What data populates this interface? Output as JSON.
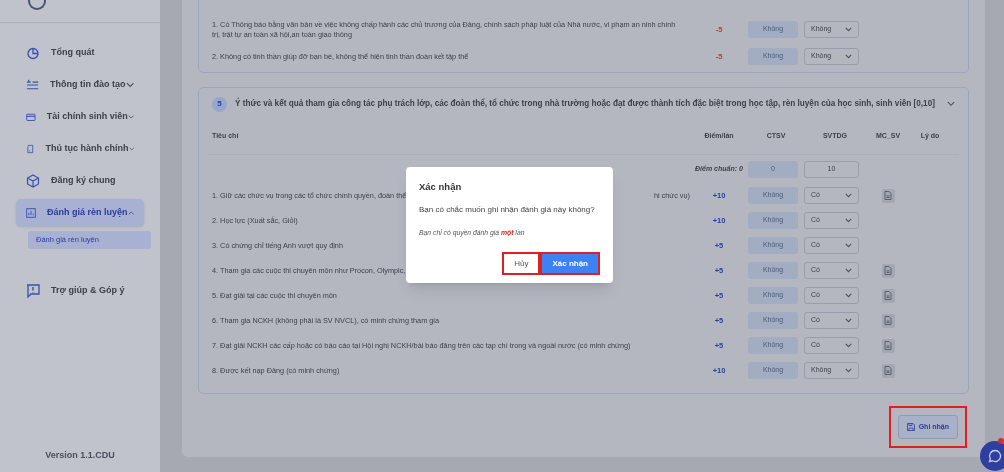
{
  "sidebar": {
    "items": [
      {
        "label": "Tổng quát",
        "selected": false
      },
      {
        "label": "Thông tin đào tạo",
        "expanded": false,
        "selected": false
      },
      {
        "label": "Tài chính sinh viên",
        "expanded": false,
        "selected": false
      },
      {
        "label": "Thủ tục hành chính",
        "expanded": false,
        "selected": false
      },
      {
        "label": "Đăng ký chung",
        "selected": false
      },
      {
        "label": "Đánh giá rèn luyện",
        "expanded": true,
        "selected": true,
        "children": [
          {
            "label": "Đánh giá rèn luyện",
            "selected": true
          }
        ]
      },
      {
        "label": "Trợ giúp & Góp ý",
        "selected": false
      }
    ],
    "version": "Version 1.1.CDU"
  },
  "section_4": {
    "penalty": true,
    "rows": [
      {
        "criterion": "1. Có Thông báo bằng văn bản về việc không chấp hành các chủ trương của Đảng, chính sách pháp luật của Nhà nước, vi phạm an ninh chính trị, trật tự an toàn xã hội,an toàn giao thông",
        "points": "-5",
        "ctsv": "Không",
        "svtdg": "Không"
      },
      {
        "criterion": "2. Không có tinh thần giúp đỡ bạn bè, không thể hiện tinh thần đoàn kết tập thể",
        "points": "-5",
        "ctsv": "Không",
        "svtdg": "Không"
      }
    ]
  },
  "section_5": {
    "number": "5",
    "title": "Ý thức và kết quả tham gia công tác phụ trách lớp, các đoàn thể, tổ chức trong nhà trường hoặc đạt được thành tích đặc biệt trong học tập, rèn luyện của học sinh, sinh viên [0,10]",
    "expanded": true,
    "penalty": false,
    "columns": [
      "Tiêu chí",
      "Điểm/lần",
      "CTSV",
      "SVTDG",
      "MC_SV",
      "Lý do"
    ],
    "baseline": {
      "label": "Điểm chuẩn: 0",
      "ctsv": "0",
      "svtdg": "10"
    },
    "rows": [
      {
        "criterion": "1. Giữ các chức vụ trong các tổ chức chính quyền, đoàn thể",
        "criterion_tail": "hi chức vụ)",
        "points": "+10",
        "ctsv": "Không",
        "svtdg": "Có",
        "has_evidence": true
      },
      {
        "criterion": "2. Học lực (Xuất sắc, Giỏi)",
        "points": "+10",
        "ctsv": "Không",
        "svtdg": "Có",
        "has_evidence": false
      },
      {
        "criterion": "3. Có chứng chỉ tiếng Anh vượt quy định",
        "points": "+5",
        "ctsv": "Không",
        "svtdg": "Có",
        "has_evidence": false
      },
      {
        "criterion": "4. Tham gia các cuộc thi chuyên môn như Procon, Olympic,",
        "points": "+5",
        "ctsv": "Không",
        "svtdg": "Có",
        "has_evidence": true
      },
      {
        "criterion": "5. Đạt giải tại các cuộc thi chuyên môn",
        "points": "+5",
        "ctsv": "Không",
        "svtdg": "Có",
        "has_evidence": true
      },
      {
        "criterion": "6. Tham gia NCKH (không phải là SV NVCL), có minh chứng tham gia",
        "points": "+5",
        "ctsv": "Không",
        "svtdg": "Có",
        "has_evidence": true
      },
      {
        "criterion": "7. Đạt giải NCKH các cấp hoặc có báo cáo tại Hội nghị NCKH/bài báo đăng trên các tạp chí trong và ngoài nước (có minh chứng)",
        "points": "+5",
        "ctsv": "Không",
        "svtdg": "Có",
        "has_evidence": true
      },
      {
        "criterion": "8. Được kết nạp Đảng (có minh chứng)",
        "points": "+10",
        "ctsv": "Không",
        "svtdg": "Không",
        "has_evidence": true
      }
    ]
  },
  "save_button": {
    "label": "Ghi nhận",
    "highlighted": true
  },
  "dialog": {
    "title": "Xác nhận",
    "message": "Bạn có chắc muốn ghi nhận đánh giá này không?",
    "note": "Bạn chỉ có quyền đánh giá **một** lần",
    "buttons": [
      {
        "label": "Hủy",
        "kind": "cancel",
        "highlighted": true
      },
      {
        "label": "Xác nhận",
        "kind": "confirm",
        "highlighted": true
      }
    ]
  }
}
